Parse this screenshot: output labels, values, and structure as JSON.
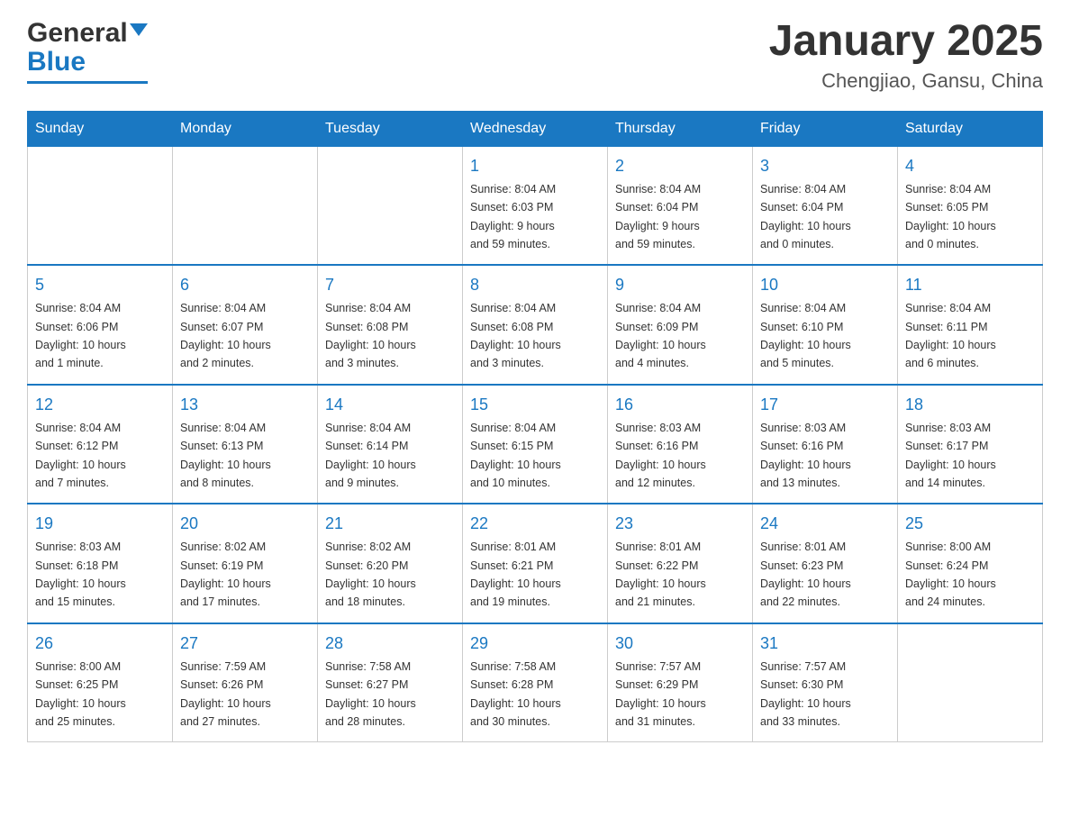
{
  "header": {
    "logo_general": "General",
    "logo_blue": "Blue",
    "title": "January 2025",
    "subtitle": "Chengjiao, Gansu, China"
  },
  "days_of_week": [
    "Sunday",
    "Monday",
    "Tuesday",
    "Wednesday",
    "Thursday",
    "Friday",
    "Saturday"
  ],
  "weeks": [
    [
      {
        "day": "",
        "info": ""
      },
      {
        "day": "",
        "info": ""
      },
      {
        "day": "",
        "info": ""
      },
      {
        "day": "1",
        "info": "Sunrise: 8:04 AM\nSunset: 6:03 PM\nDaylight: 9 hours\nand 59 minutes."
      },
      {
        "day": "2",
        "info": "Sunrise: 8:04 AM\nSunset: 6:04 PM\nDaylight: 9 hours\nand 59 minutes."
      },
      {
        "day": "3",
        "info": "Sunrise: 8:04 AM\nSunset: 6:04 PM\nDaylight: 10 hours\nand 0 minutes."
      },
      {
        "day": "4",
        "info": "Sunrise: 8:04 AM\nSunset: 6:05 PM\nDaylight: 10 hours\nand 0 minutes."
      }
    ],
    [
      {
        "day": "5",
        "info": "Sunrise: 8:04 AM\nSunset: 6:06 PM\nDaylight: 10 hours\nand 1 minute."
      },
      {
        "day": "6",
        "info": "Sunrise: 8:04 AM\nSunset: 6:07 PM\nDaylight: 10 hours\nand 2 minutes."
      },
      {
        "day": "7",
        "info": "Sunrise: 8:04 AM\nSunset: 6:08 PM\nDaylight: 10 hours\nand 3 minutes."
      },
      {
        "day": "8",
        "info": "Sunrise: 8:04 AM\nSunset: 6:08 PM\nDaylight: 10 hours\nand 3 minutes."
      },
      {
        "day": "9",
        "info": "Sunrise: 8:04 AM\nSunset: 6:09 PM\nDaylight: 10 hours\nand 4 minutes."
      },
      {
        "day": "10",
        "info": "Sunrise: 8:04 AM\nSunset: 6:10 PM\nDaylight: 10 hours\nand 5 minutes."
      },
      {
        "day": "11",
        "info": "Sunrise: 8:04 AM\nSunset: 6:11 PM\nDaylight: 10 hours\nand 6 minutes."
      }
    ],
    [
      {
        "day": "12",
        "info": "Sunrise: 8:04 AM\nSunset: 6:12 PM\nDaylight: 10 hours\nand 7 minutes."
      },
      {
        "day": "13",
        "info": "Sunrise: 8:04 AM\nSunset: 6:13 PM\nDaylight: 10 hours\nand 8 minutes."
      },
      {
        "day": "14",
        "info": "Sunrise: 8:04 AM\nSunset: 6:14 PM\nDaylight: 10 hours\nand 9 minutes."
      },
      {
        "day": "15",
        "info": "Sunrise: 8:04 AM\nSunset: 6:15 PM\nDaylight: 10 hours\nand 10 minutes."
      },
      {
        "day": "16",
        "info": "Sunrise: 8:03 AM\nSunset: 6:16 PM\nDaylight: 10 hours\nand 12 minutes."
      },
      {
        "day": "17",
        "info": "Sunrise: 8:03 AM\nSunset: 6:16 PM\nDaylight: 10 hours\nand 13 minutes."
      },
      {
        "day": "18",
        "info": "Sunrise: 8:03 AM\nSunset: 6:17 PM\nDaylight: 10 hours\nand 14 minutes."
      }
    ],
    [
      {
        "day": "19",
        "info": "Sunrise: 8:03 AM\nSunset: 6:18 PM\nDaylight: 10 hours\nand 15 minutes."
      },
      {
        "day": "20",
        "info": "Sunrise: 8:02 AM\nSunset: 6:19 PM\nDaylight: 10 hours\nand 17 minutes."
      },
      {
        "day": "21",
        "info": "Sunrise: 8:02 AM\nSunset: 6:20 PM\nDaylight: 10 hours\nand 18 minutes."
      },
      {
        "day": "22",
        "info": "Sunrise: 8:01 AM\nSunset: 6:21 PM\nDaylight: 10 hours\nand 19 minutes."
      },
      {
        "day": "23",
        "info": "Sunrise: 8:01 AM\nSunset: 6:22 PM\nDaylight: 10 hours\nand 21 minutes."
      },
      {
        "day": "24",
        "info": "Sunrise: 8:01 AM\nSunset: 6:23 PM\nDaylight: 10 hours\nand 22 minutes."
      },
      {
        "day": "25",
        "info": "Sunrise: 8:00 AM\nSunset: 6:24 PM\nDaylight: 10 hours\nand 24 minutes."
      }
    ],
    [
      {
        "day": "26",
        "info": "Sunrise: 8:00 AM\nSunset: 6:25 PM\nDaylight: 10 hours\nand 25 minutes."
      },
      {
        "day": "27",
        "info": "Sunrise: 7:59 AM\nSunset: 6:26 PM\nDaylight: 10 hours\nand 27 minutes."
      },
      {
        "day": "28",
        "info": "Sunrise: 7:58 AM\nSunset: 6:27 PM\nDaylight: 10 hours\nand 28 minutes."
      },
      {
        "day": "29",
        "info": "Sunrise: 7:58 AM\nSunset: 6:28 PM\nDaylight: 10 hours\nand 30 minutes."
      },
      {
        "day": "30",
        "info": "Sunrise: 7:57 AM\nSunset: 6:29 PM\nDaylight: 10 hours\nand 31 minutes."
      },
      {
        "day": "31",
        "info": "Sunrise: 7:57 AM\nSunset: 6:30 PM\nDaylight: 10 hours\nand 33 minutes."
      },
      {
        "day": "",
        "info": ""
      }
    ]
  ]
}
